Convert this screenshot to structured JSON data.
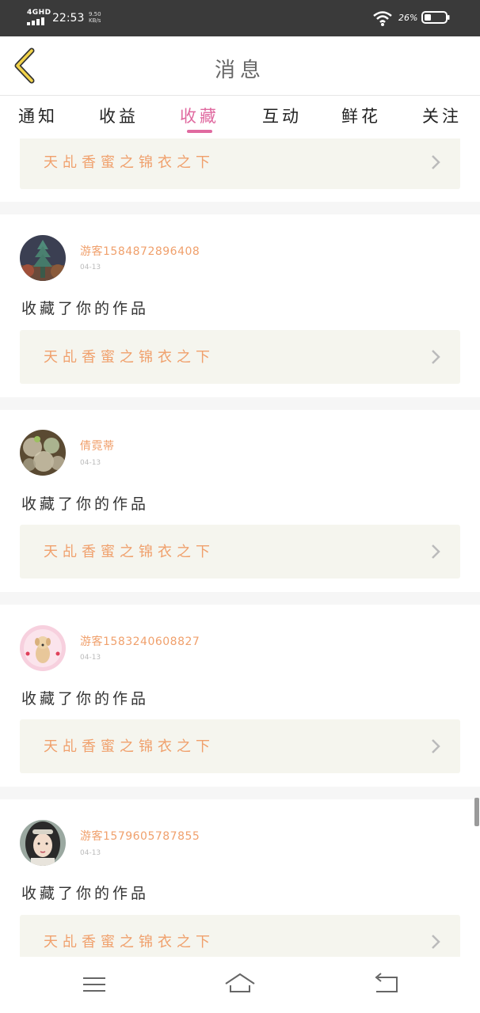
{
  "status_bar": {
    "network": "4GHD",
    "time": "22:53",
    "speed_value": "9.50",
    "speed_unit": "KB/s",
    "battery_percent": "26%",
    "icons": [
      "signal-icon",
      "wifi-icon",
      "battery-icon"
    ]
  },
  "header": {
    "title": "消息",
    "back_icon": "chevron-left-icon"
  },
  "tabs": [
    {
      "label": "通知",
      "active": false
    },
    {
      "label": "收益",
      "active": false
    },
    {
      "label": "收藏",
      "active": true
    },
    {
      "label": "互动",
      "active": false
    },
    {
      "label": "鲜花",
      "active": false
    },
    {
      "label": "关注",
      "active": false
    }
  ],
  "feed": {
    "top_partial_card": {
      "work_title": "天乩香蜜之锦衣之下"
    },
    "items": [
      {
        "username": "游客1584872896408",
        "date": "04-13",
        "action": "收藏了你的作品",
        "work_title": "天乩香蜜之锦衣之下",
        "avatar": "avatar-pagoda"
      },
      {
        "username": "倩霓蒂",
        "date": "04-13",
        "action": "收藏了你的作品",
        "work_title": "天乩香蜜之锦衣之下",
        "avatar": "avatar-bubbles"
      },
      {
        "username": "游客1583240608827",
        "date": "04-13",
        "action": "收藏了你的作品",
        "work_title": "天乩香蜜之锦衣之下",
        "avatar": "avatar-puppy"
      },
      {
        "username": "游客1579605787855",
        "date": "04-13",
        "action": "收藏了你的作品",
        "work_title": "天乩香蜜之锦衣之下",
        "avatar": "avatar-woman"
      }
    ]
  },
  "colors": {
    "accent": "#e06aa0",
    "username": "#f0a06c",
    "card_bg": "#f5f5ee",
    "status_bar": "#3a3a3a"
  },
  "navbar": {
    "icons": [
      "menu-icon",
      "home-icon",
      "back-icon"
    ]
  }
}
